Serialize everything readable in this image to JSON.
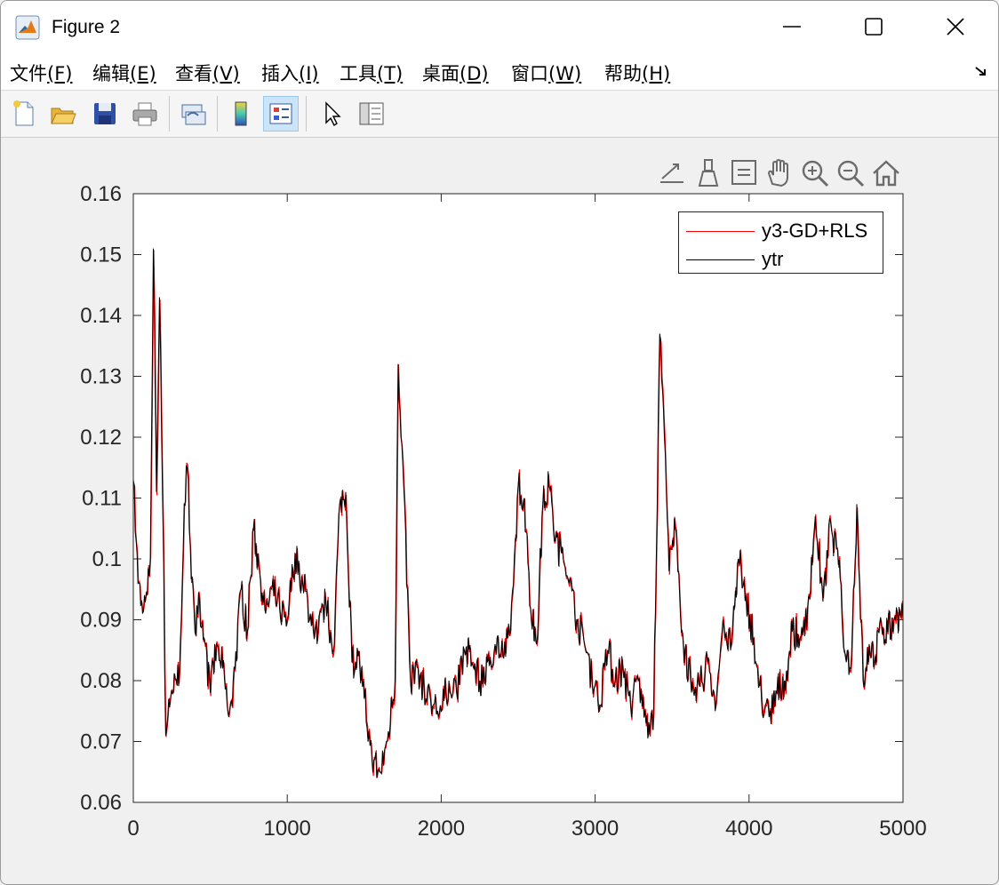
{
  "window": {
    "title": "Figure 2"
  },
  "menu": [
    {
      "label": "文件",
      "key": "(F)"
    },
    {
      "label": "编辑",
      "key": "(E)"
    },
    {
      "label": "查看",
      "key": "(V)"
    },
    {
      "label": "插入",
      "key": "(I)"
    },
    {
      "label": "工具",
      "key": "(T)"
    },
    {
      "label": "桌面",
      "key": "(D)"
    },
    {
      "label": "窗口",
      "key": "(W)"
    },
    {
      "label": "帮助",
      "key": "(H)"
    }
  ],
  "toolbar_icons": [
    "new-figure-icon",
    "open-file-icon",
    "save-icon",
    "print-icon",
    "link-plot-icon",
    "colorbar-icon",
    "legend-icon",
    "pointer-icon",
    "property-inspector-icon"
  ],
  "axes_toolbar_icons": [
    "export-icon",
    "brush-icon",
    "data-tips-icon",
    "pan-hand-icon",
    "zoom-in-icon",
    "zoom-out-icon",
    "home-icon"
  ],
  "chart_data": {
    "type": "line",
    "xlim": [
      0,
      5000
    ],
    "ylim": [
      0.06,
      0.16
    ],
    "xticks": [
      "0",
      "1000",
      "2000",
      "3000",
      "4000",
      "5000"
    ],
    "yticks": [
      "0.06",
      "0.07",
      "0.08",
      "0.09",
      "0.1",
      "0.11",
      "0.12",
      "0.13",
      "0.14",
      "0.15",
      "0.16"
    ],
    "grid": false,
    "legend_position": "top-right",
    "series": [
      {
        "name": "y3-GD+RLS",
        "color": "#ff0000"
      },
      {
        "name": "ytr",
        "color": "#000000"
      }
    ],
    "x": [
      0,
      30,
      60,
      90,
      110,
      130,
      150,
      170,
      190,
      210,
      230,
      260,
      300,
      330,
      350,
      370,
      400,
      430,
      460,
      500,
      540,
      580,
      620,
      660,
      700,
      740,
      780,
      820,
      860,
      900,
      950,
      1000,
      1050,
      1100,
      1150,
      1200,
      1250,
      1300,
      1340,
      1380,
      1420,
      1460,
      1500,
      1550,
      1600,
      1650,
      1700,
      1720,
      1750,
      1800,
      1850,
      1900,
      1950,
      2000,
      2050,
      2100,
      2150,
      2200,
      2250,
      2300,
      2350,
      2400,
      2450,
      2500,
      2540,
      2580,
      2620,
      2660,
      2700,
      2740,
      2780,
      2830,
      2880,
      2930,
      2980,
      3030,
      3080,
      3130,
      3180,
      3230,
      3280,
      3330,
      3380,
      3420,
      3450,
      3480,
      3520,
      3560,
      3620,
      3680,
      3730,
      3780,
      3830,
      3880,
      3930,
      3980,
      4030,
      4080,
      4130,
      4180,
      4230,
      4280,
      4330,
      4380,
      4430,
      4480,
      4530,
      4580,
      4620,
      4660,
      4700,
      4740,
      4780,
      4820,
      4860,
      4900,
      4940,
      4980,
      5000
    ],
    "values": [
      0.113,
      0.096,
      0.091,
      0.094,
      0.1,
      0.151,
      0.111,
      0.143,
      0.11,
      0.071,
      0.077,
      0.078,
      0.082,
      0.109,
      0.115,
      0.102,
      0.088,
      0.093,
      0.087,
      0.078,
      0.086,
      0.082,
      0.074,
      0.082,
      0.095,
      0.088,
      0.105,
      0.098,
      0.091,
      0.095,
      0.092,
      0.09,
      0.101,
      0.096,
      0.091,
      0.088,
      0.093,
      0.085,
      0.109,
      0.111,
      0.083,
      0.084,
      0.077,
      0.067,
      0.065,
      0.07,
      0.08,
      0.132,
      0.116,
      0.08,
      0.082,
      0.077,
      0.076,
      0.075,
      0.08,
      0.078,
      0.085,
      0.083,
      0.08,
      0.083,
      0.086,
      0.084,
      0.088,
      0.112,
      0.11,
      0.092,
      0.086,
      0.109,
      0.112,
      0.103,
      0.101,
      0.096,
      0.09,
      0.086,
      0.08,
      0.076,
      0.085,
      0.08,
      0.082,
      0.076,
      0.08,
      0.073,
      0.075,
      0.137,
      0.12,
      0.098,
      0.105,
      0.088,
      0.08,
      0.079,
      0.083,
      0.075,
      0.09,
      0.085,
      0.1,
      0.094,
      0.087,
      0.077,
      0.074,
      0.078,
      0.08,
      0.088,
      0.087,
      0.092,
      0.107,
      0.093,
      0.106,
      0.099,
      0.085,
      0.082,
      0.109,
      0.08,
      0.086,
      0.084,
      0.089,
      0.088,
      0.09,
      0.091,
      0.09
    ]
  }
}
